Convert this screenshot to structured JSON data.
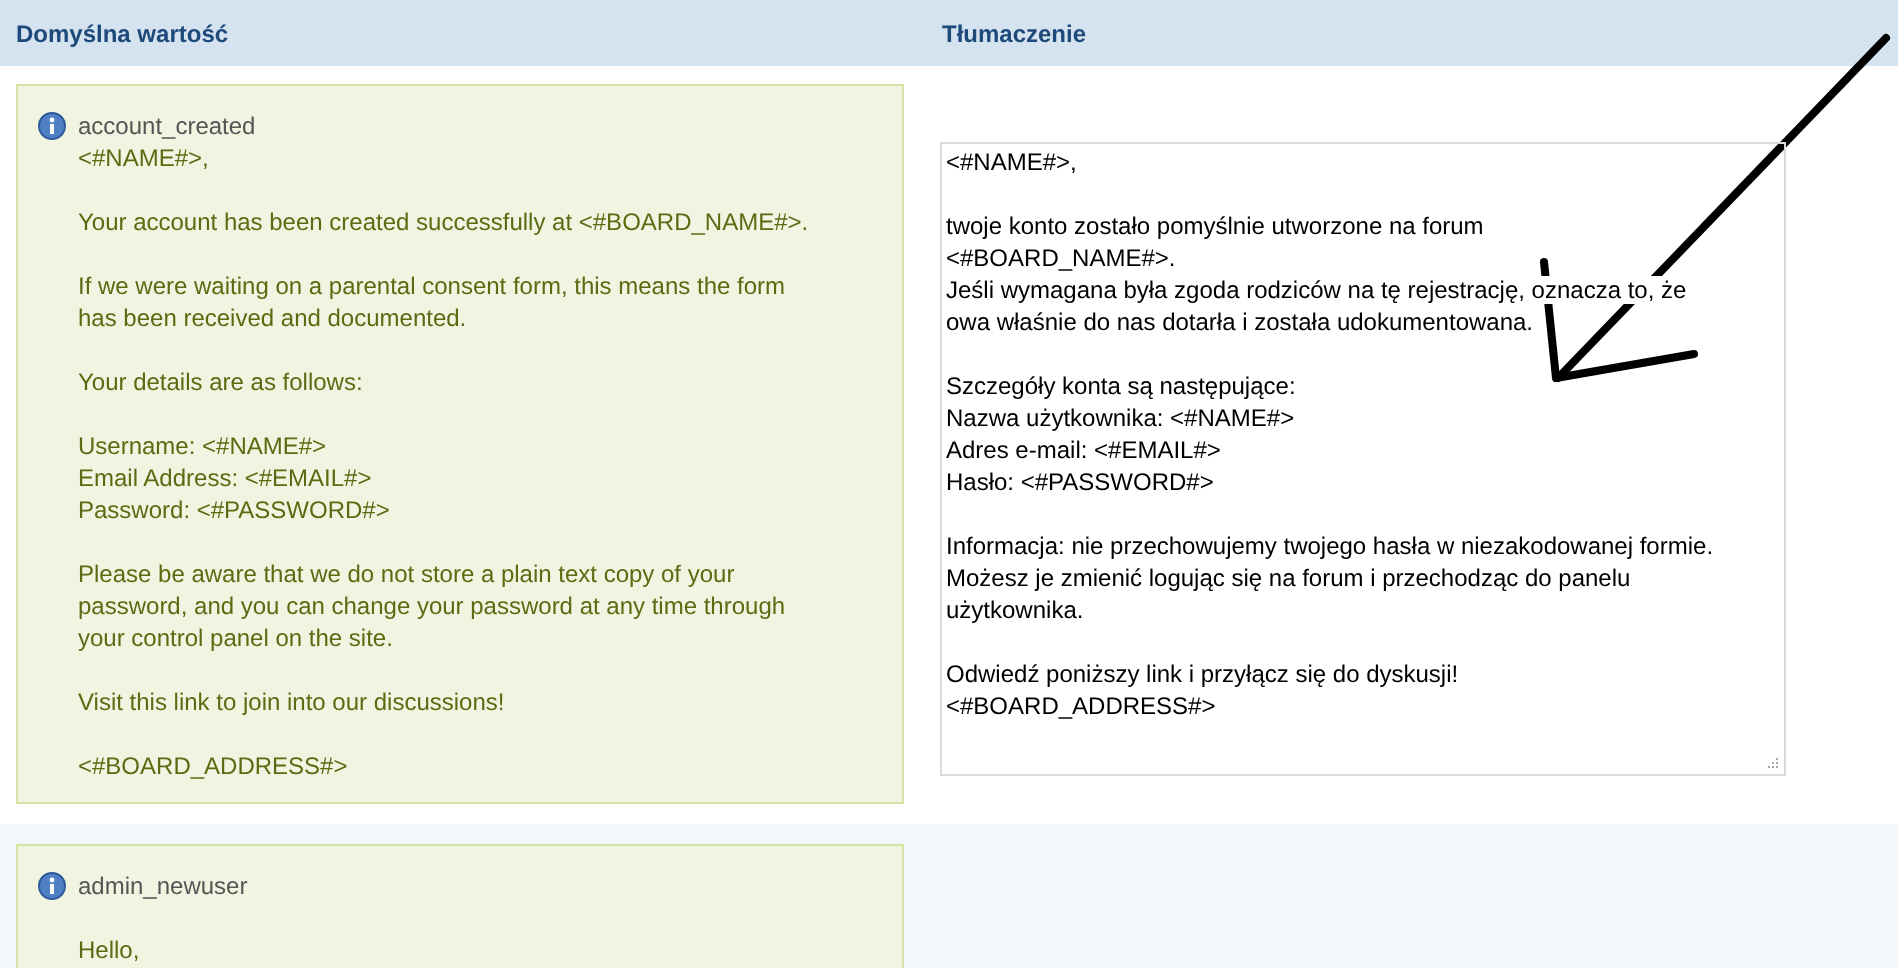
{
  "header": {
    "columns": [
      "Domyślna wartość",
      "Tłumaczenie"
    ]
  },
  "rows": [
    {
      "key": "account_created",
      "default_text": "<#NAME#>,\n\nYour account has been created successfully at <#BOARD_NAME#>.\n\nIf we were waiting on a parental consent form, this means the form\nhas been received and documented.\n\nYour details are as follows:\n\nUsername: <#NAME#>\nEmail Address: <#EMAIL#>\nPassword: <#PASSWORD#>\n\nPlease be aware that we do not store a plain text copy of your\npassword, and you can change your password at any time through\nyour control panel on the site.\n\nVisit this link to join into our discussions!\n\n<#BOARD_ADDRESS#>",
      "translation": "<#NAME#>,\n\ntwoje konto zostało pomyślnie utworzone na forum\n<#BOARD_NAME#>.\nJeśli wymagana była zgoda rodziców na tę rejestrację, oznacza to, że\nowa właśnie do nas dotarła i została udokumentowana.\n\nSzczegóły konta są następujące:\nNazwa użytkownika: <#NAME#>\nAdres e-mail: <#EMAIL#>\nHasło: <#PASSWORD#>\n\nInformacja: nie przechowujemy twojego hasła w niezakodowanej formie.\nMożesz je zmienić logując się na forum i przechodząc do panelu\nużytkownika.\n\nOdwiedź poniższy link i przyłącz się do dyskusji!\n<#BOARD_ADDRESS#>"
    },
    {
      "key": "admin_newuser",
      "default_text": "\nHello,"
    }
  ]
}
